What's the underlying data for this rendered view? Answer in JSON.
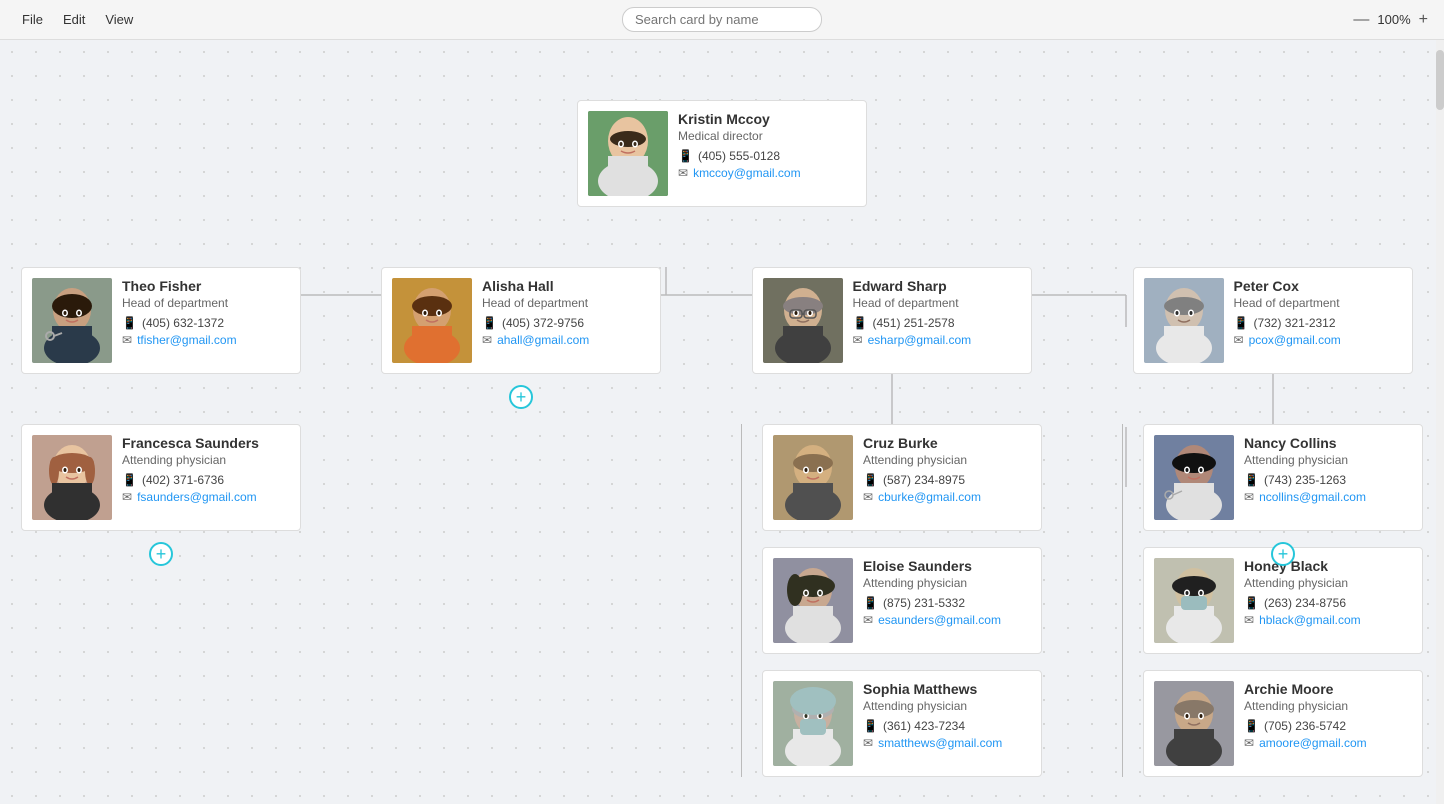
{
  "menubar": {
    "file": "File",
    "edit": "Edit",
    "view": "View",
    "zoom": "100%",
    "zoom_in": "+",
    "zoom_out": "—"
  },
  "search": {
    "placeholder": "Search card by name"
  },
  "root": {
    "name": "Kristin Mccoy",
    "role": "Medical director",
    "phone": "(405) 555-0128",
    "email": "kmccoy@gmail.com"
  },
  "branches": [
    {
      "id": "theo",
      "name": "Theo Fisher",
      "role": "Head of department",
      "phone": "(405) 632-1372",
      "email": "tfisher@gmail.com",
      "children": [
        {
          "name": "Francesca Saunders",
          "role": "Attending physician",
          "phone": "(402) 371-6736",
          "email": "fsaunders@gmail.com"
        }
      ]
    },
    {
      "id": "alisha",
      "name": "Alisha Hall",
      "role": "Head of department",
      "phone": "(405) 372-9756",
      "email": "ahall@gmail.com",
      "children": []
    },
    {
      "id": "edward",
      "name": "Edward Sharp",
      "role": "Head of department",
      "phone": "(451) 251-2578",
      "email": "esharp@gmail.com",
      "children": [
        {
          "name": "Cruz Burke",
          "role": "Attending physician",
          "phone": "(587) 234-8975",
          "email": "cburke@gmail.com"
        },
        {
          "name": "Eloise Saunders",
          "role": "Attending physician",
          "phone": "(875) 231-5332",
          "email": "esaunders@gmail.com"
        },
        {
          "name": "Sophia Matthews",
          "role": "Attending physician",
          "phone": "(361) 423-7234",
          "email": "smatthews@gmail.com"
        }
      ]
    },
    {
      "id": "peter",
      "name": "Peter Cox",
      "role": "Head of department",
      "phone": "(732) 321-2312",
      "email": "pcox@gmail.com",
      "children": [
        {
          "name": "Nancy Collins",
          "role": "Attending physician",
          "phone": "(743) 235-1263",
          "email": "ncollins@gmail.com"
        },
        {
          "name": "Honey Black",
          "role": "Attending physician",
          "phone": "(263) 234-8756",
          "email": "hblack@gmail.com"
        },
        {
          "name": "Archie Moore",
          "role": "Attending physician",
          "phone": "(705) 236-5742",
          "email": "amoore@gmail.com"
        }
      ]
    }
  ],
  "add_button_label": "+",
  "colors": {
    "email_link": "#2196F3",
    "add_btn_border": "#26C6DA",
    "add_btn_color": "#26C6DA"
  },
  "person_photos": {
    "kristin": "#b8a89a",
    "theo": "#8d7b6a",
    "alisha": "#c49a6c",
    "francesca": "#d4a5a0",
    "edward": "#a0a090",
    "peter": "#b0c0d0",
    "cruz": "#c0b090",
    "eloise": "#9090a0",
    "sophia": "#a0b0a0",
    "nancy": "#7080a0",
    "honey": "#c0c0b0",
    "archie": "#9898a0"
  }
}
